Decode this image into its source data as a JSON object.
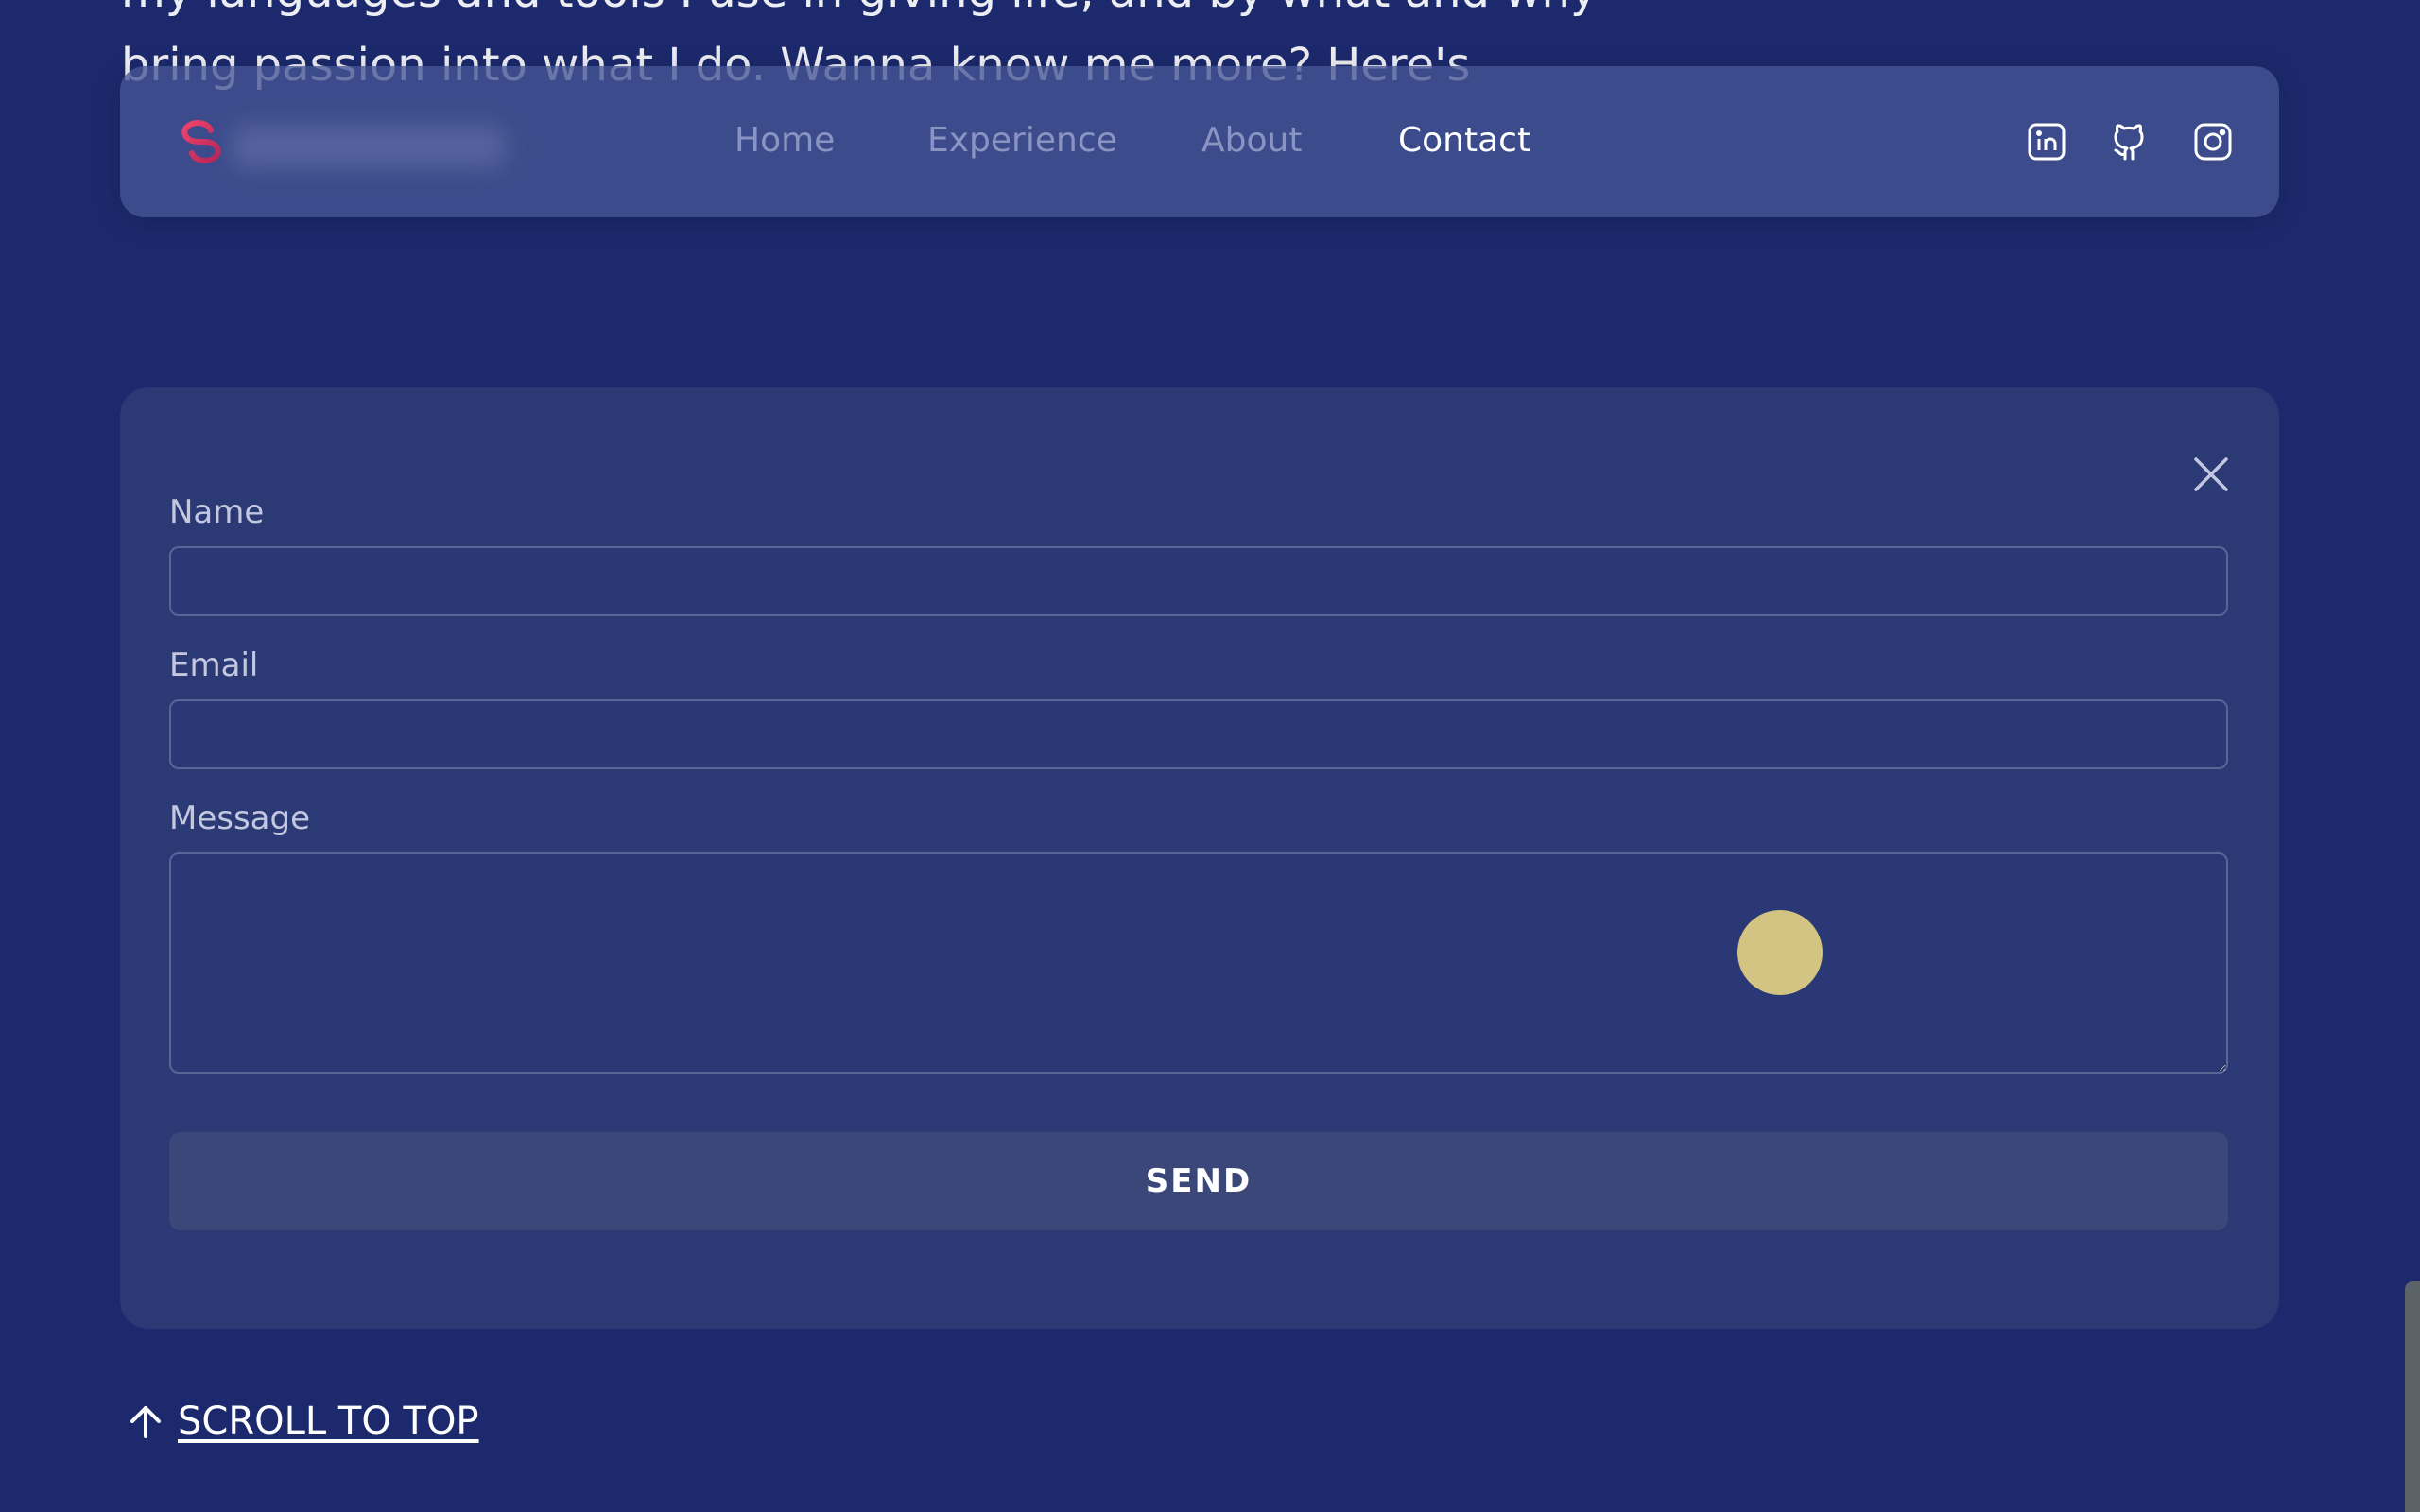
{
  "background_text": {
    "line1": "my languages and tools I use in giving life, and by what and why",
    "line2": "bring passion into what I do. Wanna know me more? Here's"
  },
  "nav": {
    "logo_icon": "brand-logo",
    "links": [
      "Home",
      "Experience",
      "About",
      "Contact"
    ],
    "active": "Contact",
    "social": [
      "linkedin-icon",
      "github-icon",
      "instagram-icon"
    ]
  },
  "contact_form": {
    "name_label": "Name",
    "name_value": "",
    "email_label": "Email",
    "email_value": "",
    "message_label": "Message",
    "message_value": "",
    "send_label": "SEND",
    "close_icon": "close-icon"
  },
  "footer": {
    "scroll_top_label": "SCROLL TO TOP",
    "scroll_top_icon": "arrow-up-icon"
  },
  "colors": {
    "page_bg": "#1c296c",
    "card_bg": "#2b3975",
    "accent_logo": "#e0365a",
    "cursor_dot": "#d4c483",
    "active_link": "#ffffff",
    "inactive_link": "#8a94c2"
  }
}
